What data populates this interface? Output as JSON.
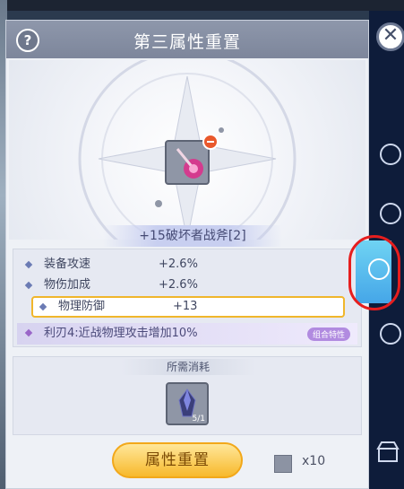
{
  "header": {
    "title": "第三属性重置",
    "help_label": "?"
  },
  "item": {
    "name": "+15破坏者战斧[2]"
  },
  "stats": [
    {
      "name": "装备攻速",
      "value": "+2.6%"
    },
    {
      "name": "物伤加成",
      "value": "+2.6%"
    },
    {
      "name": "物理防御",
      "value": "+13"
    }
  ],
  "set_effect": {
    "text": "利刃4:近战物理攻击增加10%",
    "badge": "组合特性"
  },
  "cost": {
    "title": "所需消耗",
    "count": "5/1"
  },
  "action": {
    "reset_label": "属性重置",
    "quantity": "x10"
  },
  "sidebar": {
    "close_label": "✕"
  },
  "colors": {
    "accent": "#f7b92c",
    "highlight": "#e61e1e",
    "header": "#8e97ab"
  }
}
